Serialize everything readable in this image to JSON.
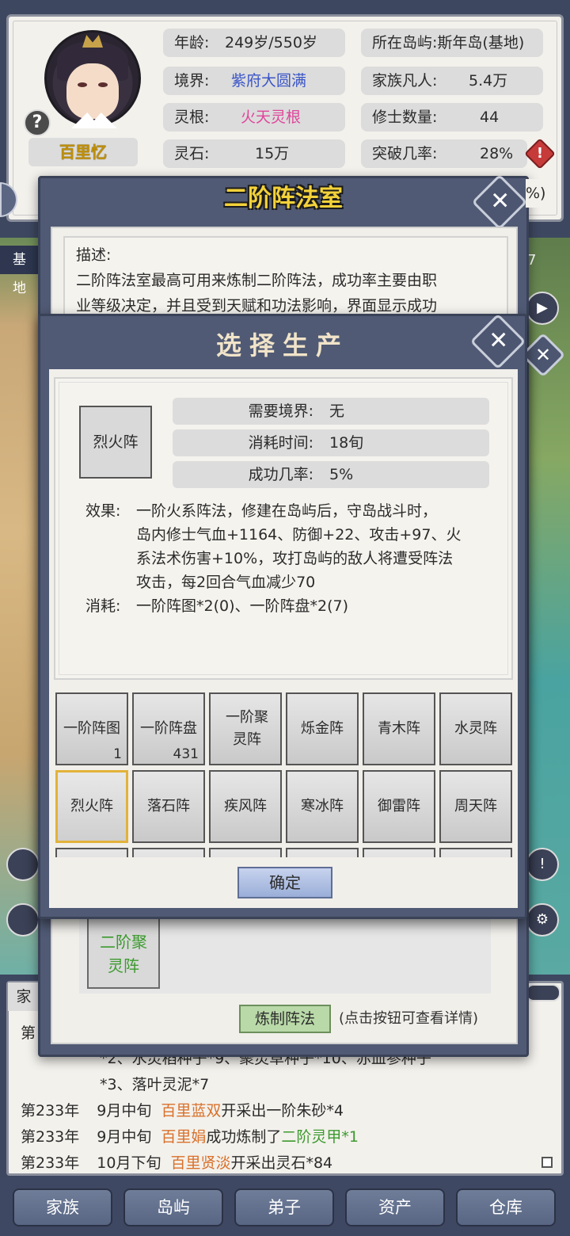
{
  "character": {
    "name": "百里忆",
    "help_symbol": "?",
    "stats_left": [
      {
        "label": "年龄:",
        "value": "249岁/550岁"
      },
      {
        "label": "境界:",
        "value": "紫府大圆满",
        "color": "#3b55c7"
      },
      {
        "label": "灵根:",
        "value": "火天灵根",
        "color": "#e0459b"
      },
      {
        "label": "灵石:",
        "value": "15万"
      }
    ],
    "stats_right": [
      {
        "label": "所在岛屿:",
        "value": "斯年岛(基地)"
      },
      {
        "label": "家族凡人:",
        "value": "5.4万"
      },
      {
        "label": "修士数量:",
        "value": "44"
      },
      {
        "label": "突破几率:",
        "value": "28%"
      }
    ],
    "warn_symbol": "!",
    "partial_right": "%)"
  },
  "map": {
    "left_tab": "基地",
    "right_num": "7",
    "play_symbol": "▶",
    "alert_symbol": "!",
    "gear_symbol": "⚙"
  },
  "dialog_room": {
    "title": "二阶阵法室",
    "close_symbol": "✕",
    "desc_label": "描述:",
    "desc_lines": [
      "二阶阵法室最高可用来炼制二阶阵法，成功率主要由职",
      "业等级决定，并且受到天赋和功法影响，界面显示成功"
    ],
    "card_label_line1": "二阶聚",
    "card_label_line2": "灵阵",
    "refine_button": "炼制阵法",
    "hint": "(点击按钮可查看详情)"
  },
  "dialog_select": {
    "title": "选择生产",
    "close_symbol": "✕",
    "selected_item": "烈火阵",
    "requirements": [
      {
        "label": "需要境界:",
        "value": "无"
      },
      {
        "label": "消耗时间:",
        "value": "18旬"
      },
      {
        "label": "成功几率:",
        "value": "5%"
      }
    ],
    "effect_label": "效果:",
    "effect_lines": [
      "一阶火系阵法，修建在岛屿后，守岛战斗时，",
      "岛内修士气血+1164、防御+22、攻击+97、火",
      "系法术伤害+10%，攻打岛屿的敌人将遭受阵法",
      "攻击，每2回合气血减少70"
    ],
    "cost_label": "消耗:",
    "cost_text": "一阶阵图*2(0)、一阶阵盘*2(7)",
    "grid": [
      {
        "label": "一阶阵图",
        "count": "1"
      },
      {
        "label": "一阶阵盘",
        "count": "431"
      },
      {
        "label": "一阶聚灵阵",
        "count": ""
      },
      {
        "label": "烁金阵",
        "count": ""
      },
      {
        "label": "青木阵",
        "count": ""
      },
      {
        "label": "水灵阵",
        "count": ""
      },
      {
        "label": "烈火阵",
        "count": "",
        "selected": true
      },
      {
        "label": "落石阵",
        "count": ""
      },
      {
        "label": "疾风阵",
        "count": ""
      },
      {
        "label": "寒冰阵",
        "count": ""
      },
      {
        "label": "御雷阵",
        "count": ""
      },
      {
        "label": "周天阵",
        "count": ""
      }
    ],
    "confirm_button": "确定"
  },
  "log": {
    "tab_partial": "家",
    "first_prefix": "第",
    "overflow_line_a": "*2、水灵稻种子*9、聚灵草种子*10、赤血参种子",
    "overflow_line_b": "*3、落叶灵泥*7",
    "entries": [
      {
        "year": "第233年",
        "time": "9月中旬",
        "who": "百里蓝双",
        "action": "开采出一阶朱砂*4",
        "item": ""
      },
      {
        "year": "第233年",
        "time": "9月中旬",
        "who": "百里娟",
        "action": "成功炼制了",
        "item": "二阶灵甲*1"
      },
      {
        "year": "第233年",
        "time": "10月下旬",
        "who": "百里贤淡",
        "action": "开采出灵石*84",
        "item": ""
      }
    ]
  },
  "nav": [
    "家族",
    "岛屿",
    "弟子",
    "资产",
    "仓库"
  ],
  "colors": {
    "realm": "#3b55c7",
    "root": "#e0459b",
    "name": "#c0900a",
    "title_gold": "#f3d23a",
    "log_person": "#d9702a",
    "log_item": "#3c9a2e"
  }
}
